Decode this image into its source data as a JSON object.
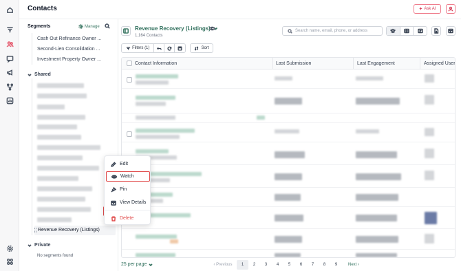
{
  "header": {
    "title": "Contacts",
    "ask_ai_label": "Ask AI"
  },
  "rail": {
    "icons": [
      "home-icon",
      "funnel-icon",
      "contacts-icon",
      "messages-icon",
      "megaphone-icon",
      "workflow-icon",
      "analytics-icon",
      "settings-icon",
      "apps-icon"
    ],
    "active": "contacts-icon",
    "accent": "#e4566a"
  },
  "segments": {
    "title": "Segments",
    "manage_label": "Manage",
    "items": [
      "Cash Out Refinance Owner ...",
      "Second-Lien Consolidation ...",
      "Investment Property Owner ..."
    ],
    "shared_label": "Shared",
    "active_segment": "Revenue Recovery (Listings)",
    "private_label": "Private",
    "no_segments_text": "No segments found"
  },
  "context_menu": {
    "items": [
      {
        "label": "Edit",
        "icon": "pencil-icon"
      },
      {
        "label": "Watch",
        "icon": "eye-icon"
      },
      {
        "label": "Pin",
        "icon": "pin-icon"
      },
      {
        "label": "View Details",
        "icon": "calendar-icon"
      },
      {
        "label": "Delete",
        "icon": "trash-icon"
      }
    ],
    "highlight": "Watch",
    "danger_color": "#e04a4a"
  },
  "main": {
    "segment_name": "Revenue Recovery (Listings)",
    "contact_count": "1,164 Contacts",
    "search_placeholder": "Search name, email, phone, or address",
    "filters_label": "Filters (1)",
    "sort_label": "Sort",
    "accent": "#2f6f5c"
  },
  "table": {
    "columns": [
      "Contact Information",
      "Last Submission",
      "Last Engagement",
      "Assigned User"
    ]
  },
  "pagination": {
    "per_page_label": "25 per page",
    "prev_label": "Previous",
    "pages": [
      "1",
      "2",
      "3",
      "4",
      "5",
      "6",
      "7",
      "8",
      "9"
    ],
    "current_page": "1",
    "next_label": "Next"
  }
}
